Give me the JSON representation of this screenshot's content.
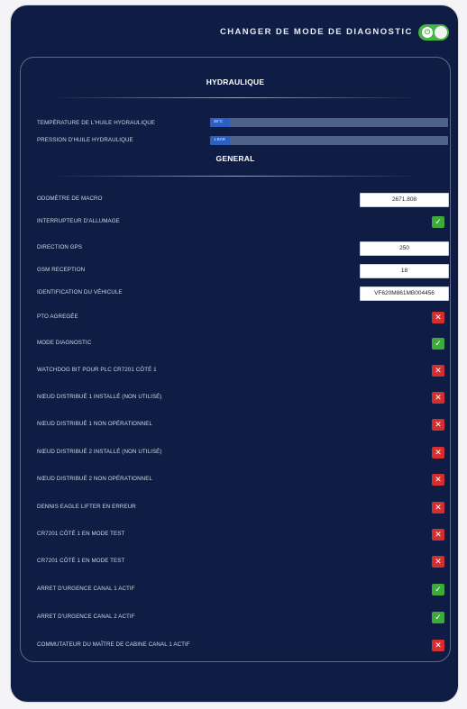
{
  "header": {
    "title": "CHANGER DE MODE DE DIAGNOSTIC",
    "toggle_symbol": "⏻",
    "toggle_on": true
  },
  "hydraulique": {
    "title": "HYDRAULIQUE",
    "rows": [
      {
        "label": "TEMPÉRATURE DE L'HUILE HYDRAULIQUE",
        "value": "36°C"
      },
      {
        "label": "PRESSION D'HUILE HYDRAULIQUE",
        "value": "1 BAR"
      }
    ]
  },
  "general": {
    "title": "GENERAL",
    "value_rows": [
      {
        "label": "ODOMÈTRE DE MACRO",
        "value": "2671.808"
      },
      {
        "label": "DIRECTION GPS",
        "value": "250"
      },
      {
        "label": "GSM RECEPTION",
        "value": "18"
      },
      {
        "label": "IDENTIFICATION DU VÉHICULE",
        "value": "VF620M861MB004456"
      }
    ],
    "status_rows": [
      {
        "label": "INTERRUPTEUR D'ALLUMAGE",
        "ok": true
      },
      {
        "label": "PTO AGREGÉE",
        "ok": false
      },
      {
        "label": "MODE DIAGNOSTIC",
        "ok": true
      },
      {
        "label": "WATCHDOG BIT POUR PLC CR7201 CÔTÉ 1",
        "ok": false
      },
      {
        "label": "NŒUD DISTRIBUÉ 1 INSTALLÉ (NON UTILISÉ)",
        "ok": false
      },
      {
        "label": "NŒUD DISTRIBUÉ 1 NON OPÉRATIONNEL",
        "ok": false
      },
      {
        "label": "NŒUD DISTRIBUÉ 2 INSTALLÉ (NON UTILISÉ)",
        "ok": false
      },
      {
        "label": "NŒUD DISTRIBUÉ 2 NON OPÉRATIONNEL",
        "ok": false
      },
      {
        "label": "DENNIS EAGLE LIFTER EN ERREUR",
        "ok": false
      },
      {
        "label": "CR7201 CÔTÉ 1 EN MODE TEST",
        "ok": false
      },
      {
        "label": "CR7201 CÔTÉ 1 EN MODE TEST",
        "ok": false
      },
      {
        "label": "ARRET D'URGENCE CANAL 1 ACTIF",
        "ok": true
      },
      {
        "label": "ARRET D'URGENCE CANAL 2 ACTIF",
        "ok": true
      },
      {
        "label": "COMMUTATEUR DU MAÎTRE DE CABINE CANAL 1 ACTIF",
        "ok": false
      }
    ]
  },
  "icons": {
    "ok": "check-icon",
    "err": "cross-icon"
  },
  "colors": {
    "background": "#0f1d45",
    "ok": "#3cab3a",
    "err": "#d62e2e",
    "toggle": "#45b548",
    "bar_fill": "#2d5ec2"
  }
}
